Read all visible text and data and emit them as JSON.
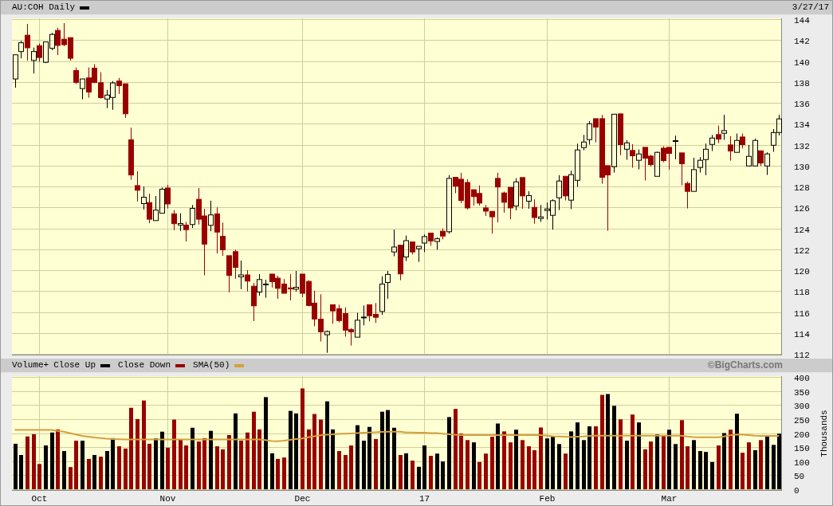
{
  "price_panel": {
    "date": "3/27/17",
    "chart_data": {
      "type": "candlestick",
      "title": "AU:COH Daily",
      "grid": true,
      "ylim": [
        112,
        144
      ],
      "yticks": [
        112,
        114,
        116,
        118,
        120,
        122,
        124,
        126,
        128,
        130,
        132,
        134,
        136,
        138,
        140,
        142,
        144
      ],
      "categories": [
        null,
        null,
        null,
        null,
        null,
        null,
        null,
        null,
        null,
        null,
        null,
        null,
        null,
        null,
        null,
        null,
        null,
        null,
        null,
        null,
        null,
        null,
        null,
        null,
        null,
        null,
        null,
        null,
        null,
        null,
        null,
        null,
        null,
        null,
        null,
        null,
        null,
        null,
        null,
        null,
        null,
        null,
        null,
        null,
        null,
        null,
        null,
        null,
        null,
        null,
        null,
        null,
        null,
        null,
        null,
        null,
        null,
        null,
        null,
        null,
        null,
        null,
        null,
        null,
        null,
        null,
        null,
        null,
        null,
        null,
        null,
        null,
        null,
        null,
        null,
        null,
        null,
        null,
        null,
        null,
        null,
        null,
        null,
        null,
        null,
        null,
        null,
        null,
        null,
        null,
        null,
        null,
        null,
        null,
        null,
        null,
        null,
        null,
        null,
        null,
        null,
        null,
        null,
        null,
        null,
        null,
        null,
        null,
        null,
        null,
        null,
        null,
        null,
        null,
        null,
        null,
        null,
        null,
        null,
        null,
        null,
        null,
        null,
        null,
        null,
        null
      ],
      "ohlc": [
        [
          138.28,
          140.59,
          137.44,
          140.59
        ],
        [
          140.9,
          141.92,
          140.26,
          141.74
        ],
        [
          142.46,
          143.54,
          140.03,
          141.26
        ],
        [
          140.05,
          141.28,
          138.8,
          140.9
        ],
        [
          141.46,
          141.67,
          139.92,
          140.33
        ],
        [
          139.87,
          141.82,
          139.8,
          141.82
        ],
        [
          141.21,
          142.69,
          141.03,
          142.54
        ],
        [
          142.92,
          143.18,
          140.56,
          141.49
        ],
        [
          142.08,
          143.62,
          141.41,
          141.56
        ],
        [
          142.23,
          142.23,
          140.03,
          140.26
        ],
        [
          139.08,
          139.38,
          137.79,
          137.95
        ],
        [
          137.36,
          138.28,
          136.33,
          138.28
        ],
        [
          138.38,
          139.38,
          136.49,
          137.03
        ],
        [
          139.31,
          139.69,
          137.87,
          137.95
        ],
        [
          137.92,
          138.92,
          136.41,
          136.49
        ],
        [
          136.36,
          137.23,
          135.49,
          136.74
        ],
        [
          136.51,
          138.08,
          135.33,
          137.9
        ],
        [
          138.08,
          138.38,
          136.85,
          137.64
        ],
        [
          137.82,
          137.82,
          134.56,
          134.95
        ],
        [
          132.46,
          133.62,
          128.64,
          129.1
        ],
        [
          128.08,
          129.46,
          126.56,
          127.64
        ],
        [
          126.36,
          128.0,
          125.79,
          126.97
        ],
        [
          126.46,
          127.31,
          124.49,
          124.87
        ],
        [
          124.74,
          127.08,
          124.74,
          125.74
        ],
        [
          125.44,
          127.9,
          125.44,
          127.74
        ],
        [
          127.85,
          128.15,
          125.9,
          126.33
        ],
        [
          125.38,
          125.74,
          123.82,
          124.44
        ],
        [
          124.31,
          125.44,
          123.74,
          124.46
        ],
        [
          124.31,
          124.62,
          122.74,
          123.87
        ],
        [
          124.36,
          126.23,
          124.03,
          125.9
        ],
        [
          126.77,
          127.85,
          124.36,
          124.87
        ],
        [
          125.18,
          125.87,
          119.51,
          122.49
        ],
        [
          124.28,
          126.64,
          123.72,
          125.28
        ],
        [
          125.38,
          126.0,
          121.59,
          123.64
        ],
        [
          123.23,
          124.54,
          121.36,
          121.95
        ],
        [
          121.38,
          121.38,
          117.87,
          119.49
        ],
        [
          121.77,
          121.97,
          119.18,
          120.26
        ],
        [
          119.36,
          120.92,
          118.18,
          119.54
        ],
        [
          119.54,
          120.0,
          117.97,
          118.95
        ],
        [
          118.46,
          118.77,
          115.13,
          116.59
        ],
        [
          117.9,
          119.62,
          117.56,
          119.1
        ],
        [
          118.6,
          119.08,
          117.36,
          118.67
        ],
        [
          119.62,
          119.62,
          118.33,
          118.9
        ],
        [
          119.23,
          119.46,
          117.26,
          118.26
        ],
        [
          118.67,
          119.15,
          117.79,
          117.79
        ],
        [
          118.3,
          119.62,
          117.1,
          118.2
        ],
        [
          118.18,
          119.92,
          117.95,
          118.36
        ],
        [
          119.62,
          119.62,
          117.41,
          117.79
        ],
        [
          118.92,
          119.03,
          116.54,
          116.62
        ],
        [
          116.85,
          118.03,
          114.64,
          115.33
        ],
        [
          115.31,
          117.69,
          113.18,
          114.1
        ],
        [
          113.82,
          114.23,
          112.1,
          114.13
        ],
        [
          116.69,
          116.69,
          114.87,
          116.1
        ],
        [
          116.31,
          116.69,
          115.0,
          115.18
        ],
        [
          115.85,
          116.44,
          113.64,
          114.26
        ],
        [
          114.31,
          114.46,
          112.79,
          114.1
        ],
        [
          113.59,
          115.92,
          113.59,
          115.21
        ],
        [
          115.51,
          116.62,
          114.72,
          115.51
        ],
        [
          116.69,
          116.69,
          115.1,
          115.64
        ],
        [
          115.77,
          116.85,
          114.95,
          115.49
        ],
        [
          116.05,
          119.41,
          115.72,
          118.67
        ],
        [
          118.82,
          119.92,
          117.26,
          119.59
        ],
        [
          121.74,
          123.87,
          121.33,
          122.21
        ],
        [
          122.38,
          122.38,
          119.03,
          119.64
        ],
        [
          121.26,
          123.31,
          120.87,
          122.82
        ],
        [
          122.69,
          122.69,
          121.49,
          121.74
        ],
        [
          122.05,
          122.28,
          120.79,
          122.28
        ],
        [
          122.59,
          123.41,
          121.72,
          123.21
        ],
        [
          123.54,
          123.54,
          122.33,
          122.79
        ],
        [
          122.74,
          123.13,
          121.95,
          123.0
        ],
        [
          123.72,
          124.0,
          122.95,
          123.26
        ],
        [
          123.67,
          129.08,
          123.49,
          128.77
        ],
        [
          128.87,
          128.87,
          127.36,
          128.03
        ],
        [
          128.69,
          129.31,
          126.41,
          126.67
        ],
        [
          128.38,
          128.69,
          125.79,
          125.95
        ],
        [
          127.69,
          127.69,
          126.18,
          127.03
        ],
        [
          127.33,
          128.1,
          126.18,
          126.41
        ],
        [
          125.95,
          126.23,
          125.18,
          125.64
        ],
        [
          125.62,
          125.62,
          123.49,
          125.1
        ],
        [
          128.77,
          129.31,
          124.56,
          127.95
        ],
        [
          127.38,
          127.51,
          125.49,
          126.49
        ],
        [
          127.92,
          127.92,
          124.87,
          125.95
        ],
        [
          126.13,
          128.79,
          125.72,
          128.44
        ],
        [
          128.85,
          128.85,
          125.87,
          127.1
        ],
        [
          126.59,
          127.54,
          125.87,
          127.13
        ],
        [
          126.0,
          126.77,
          124.44,
          125.03
        ],
        [
          124.94,
          126.23,
          124.61,
          125.09
        ],
        [
          125.7,
          126.46,
          124.84,
          125.85
        ],
        [
          125.24,
          126.77,
          123.87,
          126.64
        ],
        [
          126.92,
          129.08,
          125.75,
          128.52
        ],
        [
          128.97,
          128.97,
          126.67,
          127.1
        ],
        [
          126.69,
          129.51,
          125.83,
          129.13
        ],
        [
          128.59,
          132.1,
          127.96,
          131.49
        ],
        [
          131.72,
          132.93,
          131.46,
          132.25
        ],
        [
          132.48,
          134.25,
          132.0,
          134.0
        ],
        [
          134.48,
          134.48,
          132.22,
          133.67
        ],
        [
          134.48,
          134.84,
          128.26,
          128.87
        ],
        [
          129.99,
          129.99,
          123.77,
          129.1
        ],
        [
          129.89,
          134.91,
          129.33,
          134.91
        ],
        [
          134.94,
          134.94,
          131.0,
          132.0
        ],
        [
          131.56,
          132.43,
          130.55,
          132.17
        ],
        [
          131.44,
          132.05,
          129.79,
          130.93
        ],
        [
          130.5,
          131.54,
          129.63,
          131.11
        ],
        [
          131.74,
          131.74,
          128.57,
          130.7
        ],
        [
          130.9,
          131.03,
          129.91,
          130.09
        ],
        [
          128.97,
          131.33,
          128.97,
          131.26
        ],
        [
          131.66,
          131.84,
          130.32,
          130.47
        ],
        [
          131.74,
          131.74,
          129.61,
          131.16
        ],
        [
          132.38,
          132.86,
          130.6,
          132.38
        ],
        [
          131.21,
          131.21,
          128.11,
          130.17
        ],
        [
          128.29,
          128.47,
          125.9,
          127.53
        ],
        [
          127.53,
          130.75,
          127.53,
          129.61
        ],
        [
          129.81,
          130.8,
          129.33,
          130.5
        ],
        [
          130.57,
          132.1,
          129.08,
          131.56
        ],
        [
          132.02,
          132.93,
          131.39,
          132.63
        ],
        [
          132.96,
          133.82,
          132.15,
          132.53
        ],
        [
          133.09,
          134.86,
          132.45,
          133.34
        ],
        [
          131.97,
          132.81,
          130.47,
          131.39
        ],
        [
          131.26,
          133.06,
          131.26,
          132.4
        ],
        [
          132.73,
          133.06,
          131.64,
          132.0
        ],
        [
          129.96,
          131.97,
          129.96,
          130.88
        ],
        [
          129.96,
          132.58,
          129.96,
          132.4
        ],
        [
          131.41,
          131.41,
          129.96,
          130.24
        ],
        [
          129.96,
          131.26,
          129.1,
          131.11
        ],
        [
          131.94,
          133.49,
          131.31,
          133.16
        ],
        [
          133.16,
          134.86,
          132.88,
          134.46
        ]
      ]
    }
  },
  "volume_panel": {
    "credit": "©BigCharts.com",
    "chart_data": {
      "type": "bar",
      "grid": true,
      "title": "Volume+",
      "ylabel": "Thousands",
      "ylim": [
        0,
        400
      ],
      "yticks": [
        0,
        50,
        100,
        150,
        200,
        250,
        300,
        350,
        400
      ],
      "categories": [
        null,
        null,
        null,
        null,
        "Oct",
        null,
        null,
        null,
        null,
        null,
        null,
        null,
        null,
        null,
        null,
        null,
        null,
        null,
        null,
        null,
        null,
        null,
        null,
        null,
        null,
        "Nov",
        null,
        null,
        null,
        null,
        null,
        null,
        null,
        null,
        null,
        null,
        null,
        null,
        null,
        null,
        null,
        null,
        null,
        null,
        null,
        null,
        null,
        "Dec",
        null,
        null,
        null,
        null,
        null,
        null,
        null,
        null,
        null,
        null,
        null,
        null,
        null,
        null,
        null,
        null,
        null,
        null,
        null,
        "17",
        null,
        null,
        null,
        null,
        null,
        null,
        null,
        null,
        null,
        null,
        null,
        null,
        null,
        null,
        null,
        null,
        null,
        null,
        null,
        "Feb",
        null,
        null,
        null,
        null,
        null,
        null,
        null,
        null,
        null,
        null,
        null,
        null,
        null,
        null,
        null,
        null,
        null,
        null,
        null,
        "Mar",
        null,
        null,
        null,
        null,
        null,
        null,
        null,
        null,
        null,
        null,
        null,
        null,
        null,
        null,
        null,
        null,
        null,
        null
      ],
      "series": [
        {
          "name": "Close Up",
          "type": "bar",
          "color": "#000000",
          "values": [
            162,
            122,
            null,
            null,
            null,
            156,
            202,
            null,
            136,
            null,
            null,
            173,
            null,
            122,
            null,
            136,
            182,
            null,
            null,
            null,
            null,
            null,
            null,
            181,
            205,
            null,
            null,
            null,
            null,
            219,
            null,
            null,
            208,
            null,
            null,
            null,
            270,
            null,
            null,
            null,
            null,
            328,
            128,
            null,
            null,
            279,
            270,
            null,
            null,
            null,
            null,
            313,
            213,
            null,
            null,
            null,
            228,
            173,
            222,
            null,
            276,
            282,
            219,
            null,
            128,
            null,
            80,
            156,
            null,
            127,
            99,
            257,
            null,
            null,
            null,
            167,
            null,
            null,
            null,
            234,
            null,
            null,
            212,
            null,
            null,
            null,
            null,
            181,
            187,
            161,
            null,
            206,
            238,
            175,
            224,
            null,
            null,
            339,
            297,
            null,
            173,
            null,
            238,
            null,
            null,
            195,
            null,
            212,
            161,
            null,
            null,
            175,
            136,
            133,
            97,
            null,
            200,
            null,
            269,
            null,
            null,
            139,
            null,
            192,
            158,
            198
          ]
        },
        {
          "name": "Close Down",
          "type": "bar",
          "color": "#990000",
          "values": [
            null,
            null,
            188,
            196,
            90,
            null,
            null,
            213,
            null,
            79,
            173,
            null,
            108,
            null,
            116,
            null,
            null,
            153,
            145,
            290,
            250,
            316,
            162,
            null,
            null,
            148,
            248,
            176,
            156,
            null,
            170,
            182,
            null,
            153,
            142,
            193,
            null,
            173,
            202,
            276,
            213,
            null,
            null,
            108,
            113,
            null,
            null,
            359,
            213,
            268,
            248,
            null,
            null,
            136,
            122,
            156,
            null,
            null,
            null,
            179,
            null,
            null,
            null,
            122,
            null,
            102,
            null,
            null,
            119,
            null,
            null,
            null,
            286,
            198,
            175,
            null,
            97,
            127,
            187,
            null,
            206,
            167,
            null,
            175,
            153,
            139,
            220,
            null,
            null,
            null,
            127,
            null,
            null,
            null,
            null,
            224,
            336,
            null,
            null,
            249,
            null,
            266,
            null,
            142,
            170,
            null,
            192,
            null,
            null,
            246,
            153,
            null,
            null,
            null,
            null,
            156,
            null,
            212,
            null,
            130,
            167,
            null,
            175,
            null,
            null,
            null
          ]
        },
        {
          "name": "SMA(50)",
          "type": "line",
          "color": "#d4a040",
          "values": [
            211,
            211,
            211,
            211,
            211,
            211,
            211,
            208,
            205,
            200,
            195,
            190,
            187,
            184,
            182,
            180,
            179,
            178,
            177,
            177,
            177,
            177,
            177,
            177,
            177,
            177,
            177,
            177,
            177,
            177,
            177,
            177,
            177,
            177,
            177,
            177,
            177,
            177,
            177,
            177,
            177,
            175,
            172,
            171,
            173,
            176,
            179,
            181,
            185,
            189,
            192,
            194,
            196,
            197,
            198,
            199,
            200,
            201,
            202,
            203,
            204,
            205,
            205,
            205,
            202,
            202,
            201,
            201,
            200,
            200,
            198,
            196,
            194,
            193,
            193,
            193,
            193,
            193,
            193,
            193,
            193,
            193,
            193,
            193,
            193,
            193,
            193,
            191,
            189,
            188,
            187,
            186,
            187,
            188,
            190,
            191,
            191,
            191,
            191,
            191,
            191,
            191,
            191,
            191,
            191,
            191,
            191,
            191,
            191,
            191,
            188,
            186,
            185,
            185,
            185,
            185,
            188,
            192,
            195,
            194,
            193,
            191,
            190,
            190,
            190,
            190
          ]
        }
      ]
    }
  }
}
